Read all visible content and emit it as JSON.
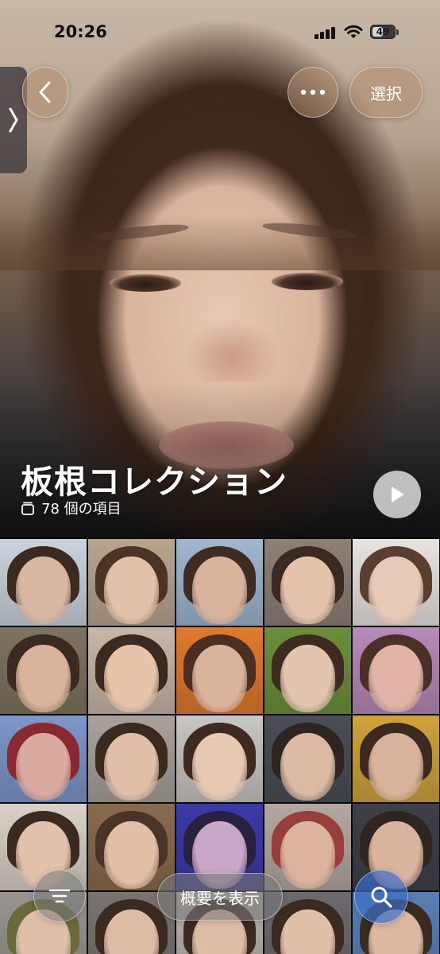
{
  "status_bar": {
    "time": "20:26",
    "battery_level": "49"
  },
  "nav": {
    "select_label": "選択"
  },
  "album": {
    "title": "板根コレクション",
    "count_label": "78 個の項目"
  },
  "bottom_bar": {
    "summary_label": "概要を表示"
  },
  "icons": {
    "back": "chevron-left-icon",
    "more": "ellipsis-icon",
    "side_tab": "chevron-right-icon",
    "stack": "stack-icon",
    "play": "play-icon",
    "sort": "sort-lines-icon",
    "search": "magnifier-icon"
  },
  "colors": {
    "search_accent": "#3c6ec8",
    "glass_tint": "#af8c6e"
  },
  "grid_tiles": [
    {
      "bg": "#cbd3dc",
      "skin": "#d8b7a2",
      "hair": "#3b2a20"
    },
    {
      "bg": "#b9a48f",
      "skin": "#e2c1ab",
      "hair": "#4a3426"
    },
    {
      "bg": "#9fb7cf",
      "skin": "#d9b49c",
      "hair": "#3e2b22"
    },
    {
      "bg": "#8d8077",
      "skin": "#e4c3aa",
      "hair": "#3a2a22"
    },
    {
      "bg": "#e9e4e0",
      "skin": "#e6c9b7",
      "hair": "#5a3f30"
    },
    {
      "bg": "#7e735f",
      "skin": "#d9b39b",
      "hair": "#3a2a1f"
    },
    {
      "bg": "#c8b7a9",
      "skin": "#e6c3a9",
      "hair": "#3b2a20"
    },
    {
      "bg": "#e07a2c",
      "skin": "#d9b39b",
      "hair": "#4a2f22"
    },
    {
      "bg": "#6c8f3a",
      "skin": "#e3c4ae",
      "hair": "#3d2b22"
    },
    {
      "bg": "#b78ab8",
      "skin": "#e0b3a6",
      "hair": "#4a3026"
    },
    {
      "bg": "#7d97c9",
      "skin": "#d9aaa0",
      "hair": "#8a2a30"
    },
    {
      "bg": "#a9a19a",
      "skin": "#e1bfa8",
      "hair": "#3b2a20"
    },
    {
      "bg": "#c9c6c3",
      "skin": "#e6c8b3",
      "hair": "#3e2a20"
    },
    {
      "bg": "#4a4d56",
      "skin": "#dcb9a3",
      "hair": "#2e2420"
    },
    {
      "bg": "#cfa33b",
      "skin": "#d8b29a",
      "hair": "#3b2a20"
    },
    {
      "bg": "#d8d2c8",
      "skin": "#e2c2ad",
      "hair": "#3a2a22"
    },
    {
      "bg": "#8b6a4c",
      "skin": "#e3bfa7",
      "hair": "#4a3428"
    },
    {
      "bg": "#3b39a8",
      "skin": "#c9a7c8",
      "hair": "#2a2040"
    },
    {
      "bg": "#b3a8a1",
      "skin": "#dcb39e",
      "hair": "#9a3d3d"
    },
    {
      "bg": "#3f3f48",
      "skin": "#d9b39b",
      "hair": "#2e2420"
    },
    {
      "bg": "#9a9591",
      "skin": "#e0c0ab",
      "hair": "#6b6a3a"
    },
    {
      "bg": "#7a7470",
      "skin": "#ddbca6",
      "hair": "#3b2a20"
    },
    {
      "bg": "#b9b3ac",
      "skin": "#dfbea8",
      "hair": "#3a2a22"
    },
    {
      "bg": "#6d6a6e",
      "skin": "#e1c0aa",
      "hair": "#3b2a20"
    },
    {
      "bg": "#5a7fb5",
      "skin": "#dcb8a1",
      "hair": "#3b2a20"
    }
  ]
}
